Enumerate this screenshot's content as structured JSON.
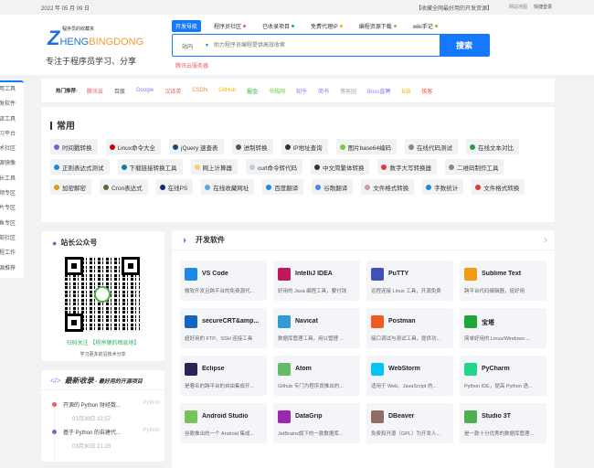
{
  "topbar": {
    "date": "2022 年 05 月 09 日",
    "bookmark": "【收藏全网最好用的开发资源】",
    "sitemap": "网站地图",
    "login": "快捷登录"
  },
  "logo": {
    "z": "Z",
    "heng": "HENG",
    "bing": "BINGDONG",
    "sub": "程序员的收藏夹",
    "slogan": "专注于程序员学习、分享"
  },
  "nav": [
    {
      "label": "开发导航",
      "color": ""
    },
    {
      "label": "程序员社区",
      "color": "#f05a5a"
    },
    {
      "label": "已收录项目",
      "color": "#22b14c"
    },
    {
      "label": "免费代理IP",
      "color": "#f5b400"
    },
    {
      "label": "编程资源下载",
      "color": "#7ac943"
    },
    {
      "label": "wiki手记",
      "color": "#7ac943"
    }
  ],
  "search": {
    "scope": "站内",
    "placeholder": "助力程序员编程提供高效收索",
    "button": "搜索",
    "ad": "腾讯云服务器"
  },
  "sidebar": [
    "常用工具",
    "开发软件",
    "翻译工具",
    "学习平台",
    "技术社区",
    "开源镜像",
    "站长工具",
    "视频专区",
    "图片专区",
    "摸鱼专区",
    "外部社区",
    "远程工作",
    "资源推荐"
  ],
  "hot": {
    "label": "热门推荐:",
    "links": [
      {
        "t": "腾讯云",
        "c": "#f05a5a"
      },
      {
        "t": "百度",
        "c": "#555"
      },
      {
        "t": "Google",
        "c": "#8a7cf0"
      },
      {
        "t": "汉译英",
        "c": "#f05a5a"
      },
      {
        "t": "CSDN",
        "c": "#f08a3c"
      },
      {
        "t": "GitHub",
        "c": "#f5b400"
      },
      {
        "t": "掘金",
        "c": "#22b14c"
      },
      {
        "t": "书栈网",
        "c": "#7ac943"
      },
      {
        "t": "知乎",
        "c": "#8a7cf0"
      },
      {
        "t": "简书",
        "c": "#8a7cf0"
      },
      {
        "t": "博客园",
        "c": "#aaa"
      },
      {
        "t": "Boss直聘",
        "c": "#8a7cf0"
      },
      {
        "t": "B站",
        "c": "#f5b400"
      },
      {
        "t": "极客",
        "c": "#f05a5a"
      }
    ]
  },
  "common": {
    "title": "常用",
    "items": [
      {
        "t": "时间戳转换",
        "c": "#6b6bd0"
      },
      {
        "t": "Linux命令大全",
        "c": "#c00"
      },
      {
        "t": "jQuery 速查表",
        "c": "#1a4a7a"
      },
      {
        "t": "进制转换",
        "c": "#555"
      },
      {
        "t": "IP地址查询",
        "c": "#333"
      },
      {
        "t": "图片base64编码",
        "c": "#7ac943"
      },
      {
        "t": "在线代码测试",
        "c": "#888"
      },
      {
        "t": "在线文本对比",
        "c": "#2a9d4a"
      },
      {
        "t": "正则表达式测试",
        "c": "#1e88e5"
      },
      {
        "t": "下载链接转换工具",
        "c": "#1a7a9a"
      },
      {
        "t": "网上计算器",
        "c": "#f5d06b"
      },
      {
        "t": "curl命令转代码",
        "c": "#bcd"
      },
      {
        "t": "中文简繁体转换",
        "c": "#333"
      },
      {
        "t": "数字大写转换器",
        "c": "#e53935"
      },
      {
        "t": "二维码制作工具",
        "c": "#888"
      },
      {
        "t": "加密解密",
        "c": "#d4a017"
      },
      {
        "t": "Cron表达式",
        "c": "#556b2f"
      },
      {
        "t": "在线PS",
        "c": "#1a237e"
      },
      {
        "t": "在线收藏网址",
        "c": "#5aa9e6"
      },
      {
        "t": "百度翻译",
        "c": "#1e88e5"
      },
      {
        "t": "谷歌翻译",
        "c": "#4285f4"
      },
      {
        "t": "文件格式转换",
        "c": "#c9a"
      },
      {
        "t": "字数统计",
        "c": "#1e88e5"
      },
      {
        "t": "文件格式转换",
        "c": "#e53935"
      }
    ]
  },
  "wechat": {
    "title": "站长公众号",
    "follow": "扫码关注 【程序猿的栖息地】",
    "sub": "学习更多前沿技术分享"
  },
  "latest": {
    "code": "</>",
    "title": "最新收录",
    "subtitle": " - 最好用的开源项目",
    "items": [
      {
        "name": "开源的 Python 财经数...",
        "tag": "Python",
        "time": "03月30日 22:57",
        "color": "#f05a5a"
      },
      {
        "name": "基于 Python 的自建代...",
        "tag": "Python",
        "time": "03月30日 21:28",
        "color": "#6b6bd0"
      }
    ]
  },
  "dev": {
    "title": "开发软件",
    "more": "›",
    "cards": [
      {
        "n": "VS Code",
        "d": "微软开发且跨平台的免费源代...",
        "c": "#1e88e5"
      },
      {
        "n": "IntelliJ IDEA",
        "d": "好用的 Java 编程工具，要付钱",
        "c": "#c2185b"
      },
      {
        "n": "PuTTY",
        "d": "远程连接 Linux 工具，开源免费",
        "c": "#3f51b5"
      },
      {
        "n": "Sublime Text",
        "d": "跨平台代码编辑器，挺好用",
        "c": "#f39c12"
      },
      {
        "n": "secureCRT&amp...",
        "d": "超好用的 FTP、SSH 连接工具",
        "c": "#1565c0"
      },
      {
        "n": "Navicat",
        "d": "数据库管理工具，用以管理 ...",
        "c": "#2e9bd6"
      },
      {
        "n": "Postman",
        "d": "接口调试与测试工具，提供功...",
        "c": "#ef5b25"
      },
      {
        "n": "宝塔",
        "d": "简单好用的 Linux/Windows ...",
        "c": "#20a53a"
      },
      {
        "n": "Eclipse",
        "d": "是著名的跨平台的自由集成开...",
        "c": "#2c2255"
      },
      {
        "n": "Atom",
        "d": "Github 专门为程序员推出的...",
        "c": "#66bb6a"
      },
      {
        "n": "WebStorm",
        "d": "适用于 Web、JavaScript 的...",
        "c": "#07c3f2"
      },
      {
        "n": "PyCharm",
        "d": "Python IDE，提高 Python 语...",
        "c": "#21d789"
      },
      {
        "n": "Android Studio",
        "d": "谷歌推出的一个 Android 集成...",
        "c": "#78c257"
      },
      {
        "n": "DataGrip",
        "d": "JetBrains旗下的一款数据库...",
        "c": "#9c27b0"
      },
      {
        "n": "DBeaver",
        "d": "免费和开源（GPL）为开发人...",
        "c": "#8d6e63"
      },
      {
        "n": "Studio 3T",
        "d": "是一款十分优秀的数据库管理...",
        "c": "#4caf50"
      }
    ]
  }
}
